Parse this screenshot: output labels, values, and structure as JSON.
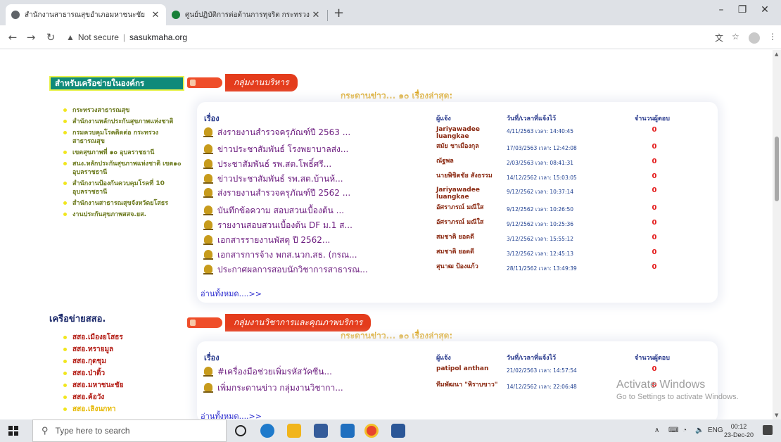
{
  "browser": {
    "tabs": [
      {
        "title": "สำนักงานสาธารณสุขอำเภอมหาชนะชัย",
        "favicon_color": "#5f6368"
      },
      {
        "title": "ศูนย์ปฏิบัติการต่อต้านการทุจริต กระทรวง",
        "favicon_color": "#188038"
      }
    ],
    "security_label": "Not secure",
    "url": "sasukmaha.org"
  },
  "sidebar": {
    "org_heading": "สำหรับเครือข่ายในองค์กร",
    "org_links": [
      "กระทรวงสาธารณสุข",
      "สำนักงานหลักประกันสุขภาพแห่งชาติ",
      "กรมควบคุมโรคติดต่อ กระทรวงสาธารณสุข",
      "เขตสุขภาพที่ ๑๐ อุบลราชธานี",
      "สนง.หลักประกันสุขภาพแห่งชาติ เขต๑๐ อุบลราชธานี",
      "สำนักงานป้องกันควบคุมโรคที่ 10 อุบลราชธานี",
      "สำนักงานสาธารณสุขจังหวัดยโสธร",
      "งานประกันสุขภาพสสจ.ยส."
    ],
    "network_heading": "เครือข่ายสสอ.",
    "network_links": [
      {
        "label": "สสอ.เมืองยโสธร",
        "highlight": false
      },
      {
        "label": "สสอ.ทรายมูล",
        "highlight": false
      },
      {
        "label": "สสอ.กุดชุม",
        "highlight": false
      },
      {
        "label": "สสอ.ป่าติ้ว",
        "highlight": false
      },
      {
        "label": "สสอ.มหาชนะชัย",
        "highlight": false
      },
      {
        "label": "สสอ.ค้อวัง",
        "highlight": false
      },
      {
        "label": "สสอ.เลิงนกทา",
        "highlight": true
      }
    ]
  },
  "boards": [
    {
      "group_banner": "กลุ่มงานบริหาร",
      "news_title": "กระดานข่าว... ๑๐ เรื่องล่าสุด:",
      "headers": {
        "subject": "เรื่อง",
        "poster": "ผู้แจ้ง",
        "datetime": "วันที่/เวลาที่แจ้งไว้",
        "replies": "จำนวนผู้ตอบ"
      },
      "rows": [
        {
          "subject": "ส่งรายงานสำรวจครุภัณฑ์ปี 2563 ...",
          "poster": "Jariyawadee luangkae",
          "datetime": "4/11/2563 เวลา: 14:40:45",
          "replies": "0"
        },
        {
          "subject": "ข่าวประชาสัมพันธ์ โรงพยาบาลส่ง...",
          "poster": "สมัย ชาเมืองกุล",
          "datetime": "17/03/2563 เวลา: 12:42:08",
          "replies": "0"
        },
        {
          "subject": "ประชาสัมพันธ์ รพ.สต.โพธิ์ศรี...",
          "poster": "ณัฐพล",
          "datetime": "2/03/2563 เวลา: 08:41:31",
          "replies": "0"
        },
        {
          "subject": "ข่าวประชาสัมพันธ์ รพ.สต.บ้านห้...",
          "poster": "นายพิชิตชัย สังธรรม",
          "datetime": "14/12/2562 เวลา: 15:03:05",
          "replies": "0"
        },
        {
          "subject": "ส่งรายงานสำรวจครุภัณฑ์ปี 2562 ...",
          "poster": "Jariyawadee luangkae",
          "datetime": "9/12/2562 เวลา: 10:37:14",
          "replies": "0"
        },
        {
          "subject": "บันทึกข้อความ สอบสวนเบื้องต้น ...",
          "poster": "อัศราภรณ์ มณีใส",
          "datetime": "9/12/2562 เวลา: 10:26:50",
          "replies": "0"
        },
        {
          "subject": "รายงานสอบสวนเบื้องต้น DF ม.1 ส...",
          "poster": "อัศราภรณ์ มณีใส",
          "datetime": "9/12/2562 เวลา: 10:25:36",
          "replies": "0"
        },
        {
          "subject": "เอกสารรายงานพัสดุ ปี 2562...",
          "poster": "สมชาติ ยอดดี",
          "datetime": "3/12/2562 เวลา: 15:55:12",
          "replies": "0"
        },
        {
          "subject": "เอกสารการจ้าง พกส.นวก.สธ. (กรณ...",
          "poster": "สมชาติ ยอดดี",
          "datetime": "3/12/2562 เวลา: 12:45:13",
          "replies": "0"
        },
        {
          "subject": "ประกาศผลการสอบนักวิชาการสาธารณ...",
          "poster": "สุนาฒ ป้องแก้ว",
          "datetime": "28/11/2562 เวลา: 13:49:39",
          "replies": "0"
        }
      ],
      "read_all": "อ่านทั้งหมด....>>"
    },
    {
      "group_banner": "กลุ่มงานวิชาการและคุณภาพบริการ",
      "news_title": "กระดานข่าว... ๑๐ เรื่องล่าสุด:",
      "headers": {
        "subject": "เรื่อง",
        "poster": "ผู้แจ้ง",
        "datetime": "วันที่/เวลาที่แจ้งไว้",
        "replies": "จำนวนผู้ตอบ"
      },
      "rows": [
        {
          "subject": "#เครื่องมือช่วยเพิ่มรหัสวัคซีน...",
          "poster": "patipol anthan",
          "datetime": "21/02/2563 เวลา: 14:57:54",
          "replies": "0"
        },
        {
          "subject": "เพิ่มกระดานข่าว กลุ่มงานวิชากา...",
          "poster": "ทีมพัฒนา \"พิราบขาว\"",
          "datetime": "14/12/2562 เวลา: 22:06:48",
          "replies": "0"
        }
      ],
      "read_all": "อ่านทั้งหมด....>>"
    }
  ],
  "watermark": {
    "line1": "Activate Windows",
    "line2": "Go to Settings to activate Windows."
  },
  "taskbar": {
    "search_placeholder": "Type here to search",
    "language": "ENG",
    "time": "00:12",
    "date": "23-Dec-20"
  }
}
